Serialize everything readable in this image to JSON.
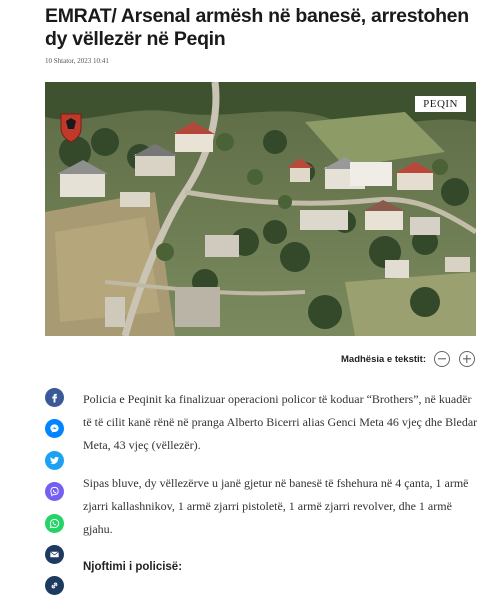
{
  "article": {
    "headline": "EMRAT/ Arsenal armësh në banesë, arrestohen dy vëllezër në Peqin",
    "date": "10 Shtator, 2023 10:41",
    "image_label": "PEQIN",
    "paragraphs": [
      "Policia e Peqinit ka finalizuar operacioni policor të koduar “Brothers”, në kuadër të të cilit kanë rënë në pranga Alberto Bicerri alias Genci Meta 46 vjeç dhe Bledar Meta, 43 vjeç (vëllezër).",
      "Sipas bluve, dy vëllezërve u janë gjetur në banesë të fshehura në 4 çanta, 1  armë zjarri kallashnikov, 1 armë zjarri pistoletë, 1 armë zjarri revolver, dhe 1 armë gjahu."
    ],
    "subheading": "Njoftimi i policisë:"
  },
  "text_size": {
    "label": "Madhësia e tekstit:"
  },
  "share": [
    {
      "name": "facebook-icon",
      "color": "#3b5998"
    },
    {
      "name": "messenger-icon",
      "color": "#0084ff"
    },
    {
      "name": "twitter-icon",
      "color": "#1da1f2"
    },
    {
      "name": "viber-icon",
      "color": "#7360f2"
    },
    {
      "name": "whatsapp-icon",
      "color": "#25d366"
    },
    {
      "name": "email-icon",
      "color": "#1e3a5f"
    },
    {
      "name": "link-icon",
      "color": "#1e3a5f"
    }
  ]
}
